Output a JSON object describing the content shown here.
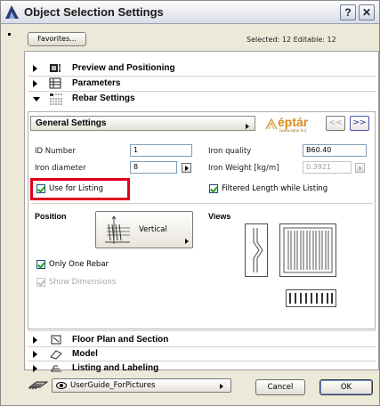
{
  "window": {
    "title": "Object Selection Settings",
    "help_label": "?",
    "close_label": "✕"
  },
  "top": {
    "favorites_label": "Favorites...",
    "selected_info": "Selected: 12 Editable: 12"
  },
  "sections_top": [
    {
      "label": "Preview and Positioning",
      "icon": "preview-icon",
      "expanded": false
    },
    {
      "label": "Parameters",
      "icon": "parameters-icon",
      "expanded": false
    },
    {
      "label": "Rebar Settings",
      "icon": "rebar-icon",
      "expanded": true
    }
  ],
  "rebar": {
    "page_select_label": "General Settings",
    "logo_text": "éptár",
    "logo_subtext": "[www.eptar.hu]",
    "prev_label": "<<",
    "next_label": ">>",
    "id_number_label": "ID Number",
    "id_number_value": "1",
    "iron_quality_label": "Iron quality",
    "iron_quality_value": "B60.40",
    "iron_diameter_label": "Iron diameter",
    "iron_diameter_value": "8",
    "iron_weight_label": "Iron Weight [kg/m]",
    "iron_weight_value": "0.3921",
    "use_for_listing_label": "Use for Listing",
    "use_for_listing_checked": true,
    "filtered_length_label": "Filtered Length while Listing",
    "filtered_length_checked": true,
    "position_title": "Position",
    "position_value": "Vertical",
    "views_title": "Views",
    "only_one_rebar_label": "Only One Rebar",
    "only_one_rebar_checked": true,
    "show_dimensions_label": "Show Dimensions",
    "show_dimensions_checked": true,
    "show_dimensions_enabled": false,
    "highlight_color": "#e0001b"
  },
  "sections_bottom": [
    {
      "label": "Floor Plan and Section",
      "icon": "floor-plan-icon",
      "expanded": false
    },
    {
      "label": "Model",
      "icon": "model-icon",
      "expanded": false
    },
    {
      "label": "Listing and Labeling",
      "icon": "listing-icon",
      "expanded": false
    }
  ],
  "footer": {
    "layer_label": "UserGuide_ForPictures",
    "cancel_label": "Cancel",
    "ok_label": "OK"
  }
}
